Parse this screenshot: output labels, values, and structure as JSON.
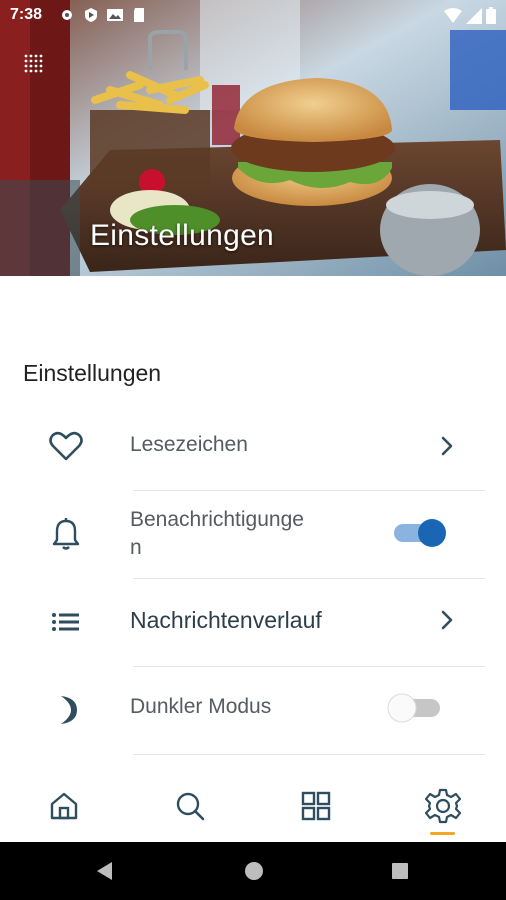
{
  "status_bar": {
    "time": "7:38"
  },
  "hero": {
    "title": "Einstellungen"
  },
  "settings": {
    "section_title": "Einstellungen",
    "items": [
      {
        "label": "Lesezeichen",
        "icon": "heart-icon",
        "control": "chevron"
      },
      {
        "label": "Benachrichtigunge\nn",
        "icon": "bell-icon",
        "control": "toggle",
        "toggle_on": true
      },
      {
        "label": "Nachrichtenverlauf",
        "icon": "list-icon",
        "control": "chevron"
      },
      {
        "label": "Dunkler Modus",
        "icon": "moon-icon",
        "control": "toggle",
        "toggle_on": false
      }
    ]
  },
  "bottom_nav": {
    "items": [
      "home-icon",
      "search-icon",
      "grid-icon",
      "settings-gear-icon"
    ],
    "active_index": 3
  },
  "colors": {
    "accent_blue": "#1a66b5",
    "icon_teal": "#2e4e5f",
    "active_underline": "#f5a623"
  }
}
